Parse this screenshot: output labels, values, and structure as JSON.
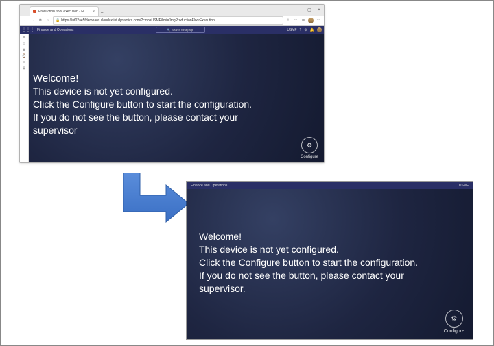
{
  "browser": {
    "tab_title": "Production floor execution - Fi…",
    "url": "https://int02ae5fdemoaos.cloudax.int.dynamics.com/?cmp=USMF&mi=JmgProductionFloorExecution",
    "nav": {
      "back": "←",
      "forward": "→",
      "refresh": "⟳",
      "home": "⌂"
    },
    "ext": {
      "a": "⋯",
      "b": "☰",
      "c": "⤓",
      "d": "⚙"
    },
    "win": {
      "min": "—",
      "max": "▢",
      "close": "✕"
    },
    "tab_close": "✕",
    "new_tab": "+"
  },
  "fo": {
    "brand": "Finance and Operations",
    "search_placeholder": "Search for a page",
    "company": "USMF",
    "icons": {
      "waffle": "⋮⋮⋮",
      "mag": "🔍",
      "q": "?",
      "gear": "⚙",
      "bell": "🔔"
    },
    "rail": [
      "≡",
      "☆",
      "⊕",
      "⌚",
      "▭",
      "⊞"
    ]
  },
  "message": {
    "hello": "Welcome!",
    "l1": "This device is not yet configured.",
    "l2": "Click the Configure button to start the configuration.",
    "l3": "If you do not see the button, please contact your",
    "l4_cut": "supervisor",
    "l4": "supervisor."
  },
  "configure": {
    "icon": "⚙",
    "label": "Configure"
  }
}
